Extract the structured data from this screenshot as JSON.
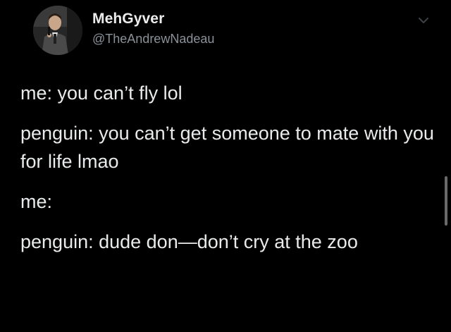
{
  "tweet": {
    "display_name": "MehGyver",
    "handle": "@TheAndrewNadeau",
    "lines": [
      "me: you can’t fly lol",
      "penguin: you can’t get someone to mate with you for life lmao",
      "me:",
      "penguin: dude don—don’t cry at the zoo"
    ]
  },
  "icons": {
    "avatar": "avatar-photo",
    "caret": "chevron-down-icon"
  },
  "colors": {
    "background": "#000000",
    "text": "#e9eaeb",
    "handle": "#8b9198"
  }
}
